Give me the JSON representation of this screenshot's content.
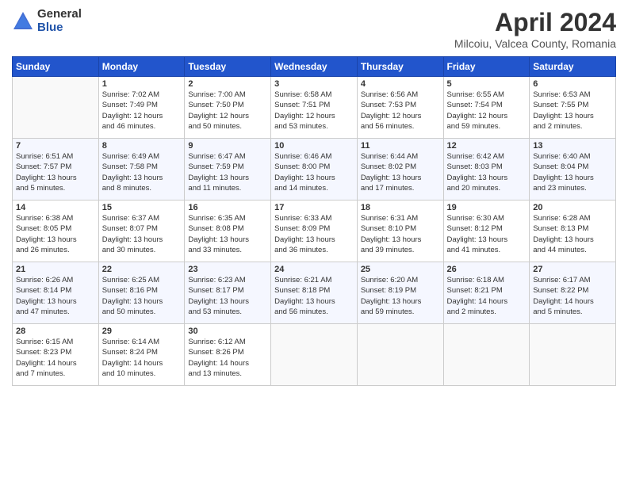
{
  "header": {
    "logo_general": "General",
    "logo_blue": "Blue",
    "title": "April 2024",
    "location": "Milcoiu, Valcea County, Romania"
  },
  "days_of_week": [
    "Sunday",
    "Monday",
    "Tuesday",
    "Wednesday",
    "Thursday",
    "Friday",
    "Saturday"
  ],
  "weeks": [
    [
      {
        "day": "",
        "info": ""
      },
      {
        "day": "1",
        "info": "Sunrise: 7:02 AM\nSunset: 7:49 PM\nDaylight: 12 hours\nand 46 minutes."
      },
      {
        "day": "2",
        "info": "Sunrise: 7:00 AM\nSunset: 7:50 PM\nDaylight: 12 hours\nand 50 minutes."
      },
      {
        "day": "3",
        "info": "Sunrise: 6:58 AM\nSunset: 7:51 PM\nDaylight: 12 hours\nand 53 minutes."
      },
      {
        "day": "4",
        "info": "Sunrise: 6:56 AM\nSunset: 7:53 PM\nDaylight: 12 hours\nand 56 minutes."
      },
      {
        "day": "5",
        "info": "Sunrise: 6:55 AM\nSunset: 7:54 PM\nDaylight: 12 hours\nand 59 minutes."
      },
      {
        "day": "6",
        "info": "Sunrise: 6:53 AM\nSunset: 7:55 PM\nDaylight: 13 hours\nand 2 minutes."
      }
    ],
    [
      {
        "day": "7",
        "info": "Sunrise: 6:51 AM\nSunset: 7:57 PM\nDaylight: 13 hours\nand 5 minutes."
      },
      {
        "day": "8",
        "info": "Sunrise: 6:49 AM\nSunset: 7:58 PM\nDaylight: 13 hours\nand 8 minutes."
      },
      {
        "day": "9",
        "info": "Sunrise: 6:47 AM\nSunset: 7:59 PM\nDaylight: 13 hours\nand 11 minutes."
      },
      {
        "day": "10",
        "info": "Sunrise: 6:46 AM\nSunset: 8:00 PM\nDaylight: 13 hours\nand 14 minutes."
      },
      {
        "day": "11",
        "info": "Sunrise: 6:44 AM\nSunset: 8:02 PM\nDaylight: 13 hours\nand 17 minutes."
      },
      {
        "day": "12",
        "info": "Sunrise: 6:42 AM\nSunset: 8:03 PM\nDaylight: 13 hours\nand 20 minutes."
      },
      {
        "day": "13",
        "info": "Sunrise: 6:40 AM\nSunset: 8:04 PM\nDaylight: 13 hours\nand 23 minutes."
      }
    ],
    [
      {
        "day": "14",
        "info": "Sunrise: 6:38 AM\nSunset: 8:05 PM\nDaylight: 13 hours\nand 26 minutes."
      },
      {
        "day": "15",
        "info": "Sunrise: 6:37 AM\nSunset: 8:07 PM\nDaylight: 13 hours\nand 30 minutes."
      },
      {
        "day": "16",
        "info": "Sunrise: 6:35 AM\nSunset: 8:08 PM\nDaylight: 13 hours\nand 33 minutes."
      },
      {
        "day": "17",
        "info": "Sunrise: 6:33 AM\nSunset: 8:09 PM\nDaylight: 13 hours\nand 36 minutes."
      },
      {
        "day": "18",
        "info": "Sunrise: 6:31 AM\nSunset: 8:10 PM\nDaylight: 13 hours\nand 39 minutes."
      },
      {
        "day": "19",
        "info": "Sunrise: 6:30 AM\nSunset: 8:12 PM\nDaylight: 13 hours\nand 41 minutes."
      },
      {
        "day": "20",
        "info": "Sunrise: 6:28 AM\nSunset: 8:13 PM\nDaylight: 13 hours\nand 44 minutes."
      }
    ],
    [
      {
        "day": "21",
        "info": "Sunrise: 6:26 AM\nSunset: 8:14 PM\nDaylight: 13 hours\nand 47 minutes."
      },
      {
        "day": "22",
        "info": "Sunrise: 6:25 AM\nSunset: 8:16 PM\nDaylight: 13 hours\nand 50 minutes."
      },
      {
        "day": "23",
        "info": "Sunrise: 6:23 AM\nSunset: 8:17 PM\nDaylight: 13 hours\nand 53 minutes."
      },
      {
        "day": "24",
        "info": "Sunrise: 6:21 AM\nSunset: 8:18 PM\nDaylight: 13 hours\nand 56 minutes."
      },
      {
        "day": "25",
        "info": "Sunrise: 6:20 AM\nSunset: 8:19 PM\nDaylight: 13 hours\nand 59 minutes."
      },
      {
        "day": "26",
        "info": "Sunrise: 6:18 AM\nSunset: 8:21 PM\nDaylight: 14 hours\nand 2 minutes."
      },
      {
        "day": "27",
        "info": "Sunrise: 6:17 AM\nSunset: 8:22 PM\nDaylight: 14 hours\nand 5 minutes."
      }
    ],
    [
      {
        "day": "28",
        "info": "Sunrise: 6:15 AM\nSunset: 8:23 PM\nDaylight: 14 hours\nand 7 minutes."
      },
      {
        "day": "29",
        "info": "Sunrise: 6:14 AM\nSunset: 8:24 PM\nDaylight: 14 hours\nand 10 minutes."
      },
      {
        "day": "30",
        "info": "Sunrise: 6:12 AM\nSunset: 8:26 PM\nDaylight: 14 hours\nand 13 minutes."
      },
      {
        "day": "",
        "info": ""
      },
      {
        "day": "",
        "info": ""
      },
      {
        "day": "",
        "info": ""
      },
      {
        "day": "",
        "info": ""
      }
    ]
  ]
}
